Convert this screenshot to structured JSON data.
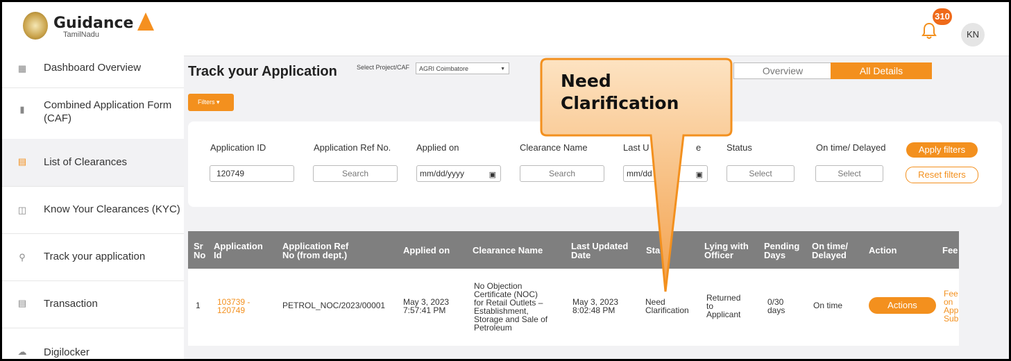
{
  "header": {
    "logo_title": "Guidance",
    "logo_subtitle": "TamilNadu",
    "notification_count": "310",
    "avatar_initials": "KN"
  },
  "sidebar": {
    "items": [
      {
        "label": "Dashboard Overview",
        "icon": "dashboard-icon"
      },
      {
        "label": "Combined Application Form (CAF)",
        "icon": "document-icon"
      },
      {
        "label": "List of Clearances",
        "icon": "list-icon"
      },
      {
        "label": "Know Your Clearances (KYC)",
        "icon": "book-icon"
      },
      {
        "label": "Track your application",
        "icon": "location-pin-icon"
      },
      {
        "label": "Transaction",
        "icon": "transaction-icon"
      },
      {
        "label": "Digilocker",
        "icon": "cloud-icon"
      }
    ]
  },
  "main": {
    "title": "Track your Application",
    "select_label": "Select Project/CAF",
    "select_value": "AGRI Coimbatore",
    "tab_overview": "Overview",
    "tab_all_details": "All Details",
    "filters_label": "Filters"
  },
  "filters": {
    "labels": [
      "Application ID",
      "Application Ref No.",
      "Applied on",
      "Clearance Name",
      "Last U",
      "e",
      "Status",
      "On time/ Delayed"
    ],
    "application_id_value": "120749",
    "search_placeholder": "Search",
    "date_placeholder": "mm/dd/yyyy",
    "date_partial": "mm/dd",
    "select_placeholder": "Select",
    "apply_label": "Apply filters",
    "reset_label": "Reset filters"
  },
  "table": {
    "headers": [
      {
        "line1": "Sr",
        "line2": "No"
      },
      {
        "line1": "Application",
        "line2": "Id"
      },
      {
        "line1": "Application Ref",
        "line2": "No (from dept.)"
      },
      {
        "line1": "Applied on",
        "line2": ""
      },
      {
        "line1": "Clearance Name",
        "line2": ""
      },
      {
        "line1": "Last Updated",
        "line2": "Date"
      },
      {
        "line1": "Sta",
        "line2": ""
      },
      {
        "line1": "Lying with",
        "line2": "Officer"
      },
      {
        "line1": "Pending",
        "line2": "Days"
      },
      {
        "line1": "On time/",
        "line2": "Delayed"
      },
      {
        "line1": "Action",
        "line2": ""
      },
      {
        "line1": "Fee",
        "line2": ""
      }
    ],
    "rows": [
      {
        "sr": "1",
        "app_id_1": "103739 -",
        "app_id_2": "120749",
        "ref_no": "PETROL_NOC/2023/00001",
        "applied_1": "May 3, 2023",
        "applied_2": "7:57:41 PM",
        "clearance": [
          "No Objection",
          "Certificate (NOC)",
          "for Retail Outlets –",
          "Establishment,",
          "Storage and Sale of",
          "Petroleum"
        ],
        "updated_1": "May 3, 2023",
        "updated_2": "8:02:48 PM",
        "status_1": "Need",
        "status_2": "Clarification",
        "lying": [
          "Returned",
          "to",
          "Applicant"
        ],
        "pending_1": "0/30",
        "pending_2": "days",
        "ontime": "On time",
        "action": "Actions",
        "fee": [
          "Fee",
          "on",
          "App",
          "Sub"
        ]
      }
    ]
  },
  "callout": {
    "line1": "Need",
    "line2": "Clarification"
  },
  "colors": {
    "accent": "#f3901e",
    "table_header": "#7f7f7f",
    "badge": "#ef6a1a"
  }
}
